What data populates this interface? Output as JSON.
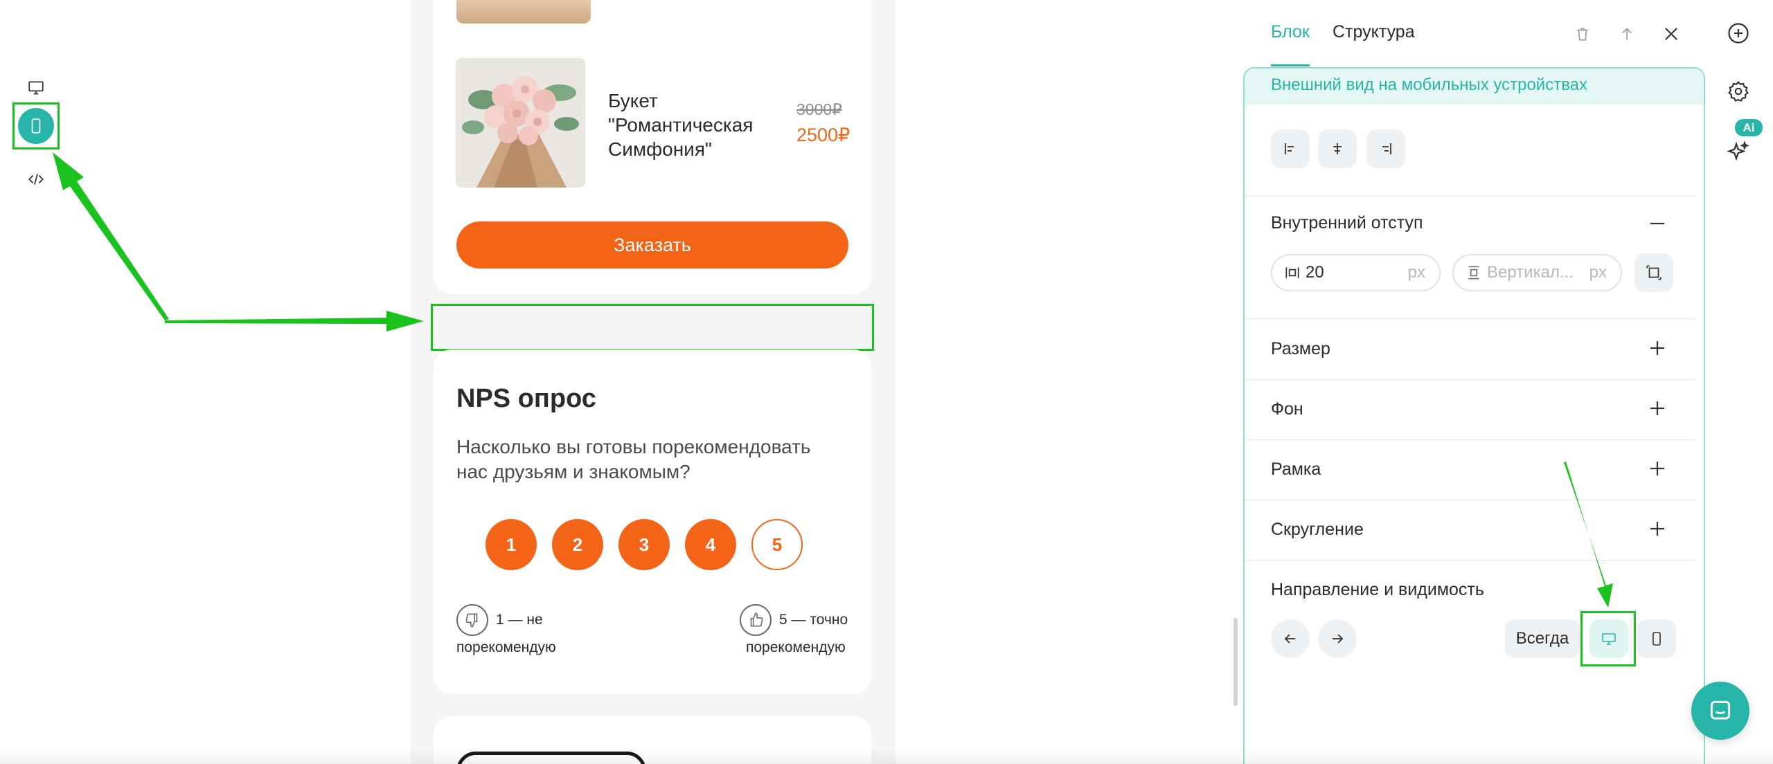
{
  "device_toolbar": {
    "items": [
      {
        "icon": "desktop-icon",
        "active": false
      },
      {
        "icon": "mobile-icon",
        "active": true
      },
      {
        "icon": "code-icon",
        "active": false
      }
    ]
  },
  "preview": {
    "product": {
      "name": "Букет \"Романтическая Симфония\"",
      "old_price": "3000₽",
      "new_price": "2500₽"
    },
    "order_button": "Заказать",
    "nps": {
      "title": "NPS опрос",
      "question": "Насколько вы готовы порекомендовать нас друзьям и знакомым?",
      "scores": [
        "1",
        "2",
        "3",
        "4",
        "5"
      ],
      "low_label_line1": "1 — не",
      "low_label_line2": "порекомендую",
      "high_label_line1": "5 — точно",
      "high_label_line2": "порекомендую"
    }
  },
  "panel": {
    "tabs": [
      {
        "label": "Блок",
        "active": true
      },
      {
        "label": "Структура",
        "active": false
      }
    ],
    "mobile_banner": "Внешний вид на мобильных устройствах",
    "inner_padding": {
      "label": "Внутренний отступ",
      "horizontal_value": "20",
      "unit": "px",
      "vertical_placeholder": "Вертикал..."
    },
    "sections": [
      "Размер",
      "Фон",
      "Рамка",
      "Скругление"
    ],
    "direction": {
      "label": "Направление и видимость",
      "always_label": "Всегда",
      "selected": "desktop"
    }
  },
  "rail": {
    "ai_badge": "Ai"
  },
  "colors": {
    "accent": "#26b5a8",
    "orange": "#f36416",
    "highlight": "#19c21c"
  }
}
